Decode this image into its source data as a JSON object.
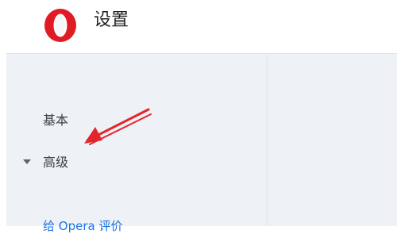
{
  "header": {
    "title": "设置",
    "logo_icon": "opera-logo-icon",
    "brand_color": "#e01b24"
  },
  "sidebar": {
    "items": [
      {
        "label": "基本"
      },
      {
        "label": "高级",
        "icon": "caret-down-icon"
      }
    ],
    "partial_link": "给 Opera 评价"
  },
  "annotation": {
    "icon": "red-arrow-icon",
    "color": "#e3262b"
  }
}
